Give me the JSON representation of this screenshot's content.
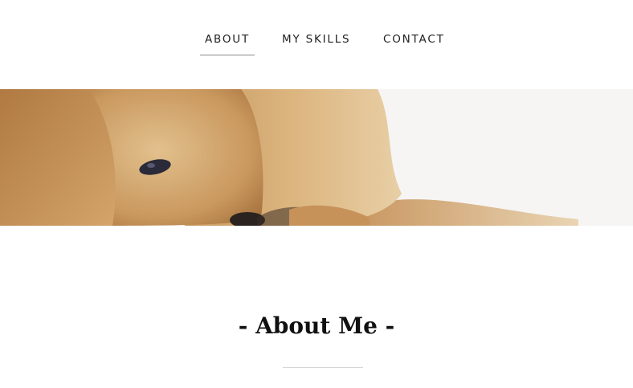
{
  "nav": {
    "items": [
      {
        "label": "ABOUT",
        "active": true
      },
      {
        "label": "MY SKILLS",
        "active": false
      },
      {
        "label": "CONTACT",
        "active": false
      }
    ]
  },
  "hero": {
    "image": "puppy-photo-banner",
    "colors": {
      "fur_dark": "#b98a55",
      "fur_light": "#e3c494",
      "background": "#f6f5f4"
    }
  },
  "about": {
    "title": "- About Me -"
  }
}
